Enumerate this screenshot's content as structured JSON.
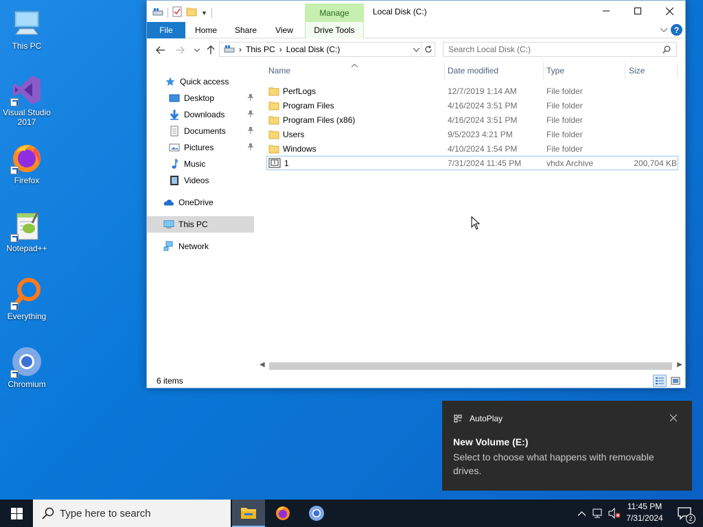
{
  "desktop": {
    "icons": [
      {
        "label": "This PC"
      },
      {
        "label": "Visual Studio 2017"
      },
      {
        "label": "Firefox"
      },
      {
        "label": "Notepad++"
      },
      {
        "label": "Everything"
      },
      {
        "label": "Chromium"
      }
    ]
  },
  "explorer": {
    "contextual_tab": "Manage",
    "title": "Local Disk (C:)",
    "ribbon_tabs": [
      "File",
      "Home",
      "Share",
      "View",
      "Drive Tools"
    ],
    "help_label": "?",
    "address": {
      "crumbs": [
        "This PC",
        "Local Disk (C:)"
      ]
    },
    "search_placeholder": "Search Local Disk (C:)",
    "nav": {
      "quick_access": "Quick access",
      "items": [
        "Desktop",
        "Downloads",
        "Documents",
        "Pictures",
        "Music",
        "Videos"
      ],
      "onedrive": "OneDrive",
      "this_pc": "This PC",
      "network": "Network"
    },
    "columns": {
      "name": "Name",
      "date": "Date modified",
      "type": "Type",
      "size": "Size"
    },
    "files": [
      {
        "name": "PerfLogs",
        "date": "12/7/2019 1:14 AM",
        "type": "File folder",
        "size": ""
      },
      {
        "name": "Program Files",
        "date": "4/16/2024 3:51 PM",
        "type": "File folder",
        "size": ""
      },
      {
        "name": "Program Files (x86)",
        "date": "4/16/2024 3:51 PM",
        "type": "File folder",
        "size": ""
      },
      {
        "name": "Users",
        "date": "9/5/2023 4:21 PM",
        "type": "File folder",
        "size": ""
      },
      {
        "name": "Windows",
        "date": "4/10/2024 1:54 PM",
        "type": "File folder",
        "size": ""
      },
      {
        "name": "1",
        "date": "7/31/2024 11:45 PM",
        "type": "vhdx Archive",
        "size": "200,704 KB"
      }
    ],
    "status": "6 items"
  },
  "toast": {
    "app": "AutoPlay",
    "title": "New Volume (E:)",
    "body": "Select to choose what happens with removable drives."
  },
  "taskbar": {
    "search_placeholder": "Type here to search",
    "time": "11:45 PM",
    "date": "7/31/2024",
    "notification_count": "2"
  },
  "colors": {
    "accent": "#1979ca",
    "taskbar": "#101a26",
    "manage_tab": "#c6efb0",
    "folder": "#f8d775"
  }
}
